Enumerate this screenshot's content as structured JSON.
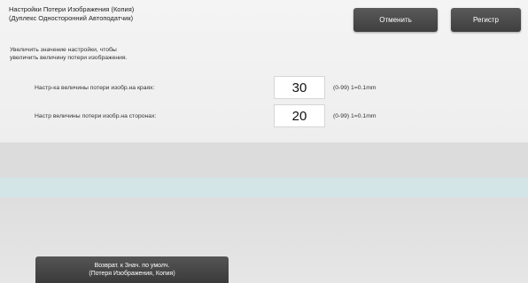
{
  "header": {
    "title_line1": "Настройки Потери Изображения (Копия)",
    "title_line2": "(Дуплекс Односторонний Автоподатчик)",
    "cancel_label": "Отменить",
    "register_label": "Регистр"
  },
  "description": {
    "line1": "Увеличить значение настройки, чтобы",
    "line2": "увеличить величину потери изображения."
  },
  "settings": [
    {
      "label": "Настр-ка величины потери изобр.на краях:",
      "value": "30",
      "range": "(0-99) 1=0.1mm"
    },
    {
      "label": "Настр величины потери изобр.на сторонах:",
      "value": "20",
      "range": "(0-99) 1=0.1mm"
    }
  ],
  "footer": {
    "default_line1": "Возврат. к Знач. по умолч.",
    "default_line2": "(Потеря Изображения, Копия)"
  },
  "colors": {
    "button_bg": "#444444",
    "accent_band": "#d3e5e7"
  }
}
